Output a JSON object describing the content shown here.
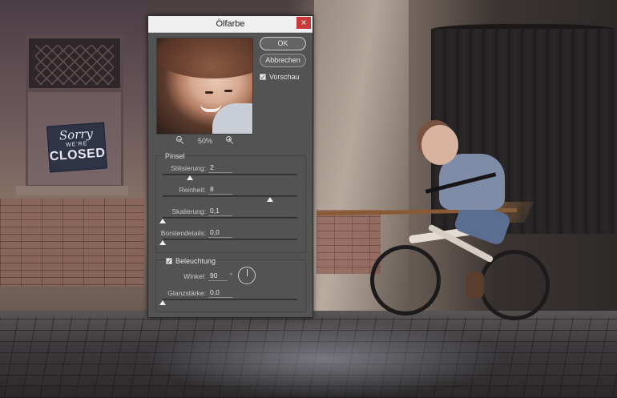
{
  "dialog": {
    "title": "Ölfarbe",
    "close_label": "×",
    "ok_label": "OK",
    "cancel_label": "Abbrechen",
    "preview_label": "Vorschau",
    "preview_checked": true,
    "zoom": "50%"
  },
  "pinsel": {
    "label": "Pinsel",
    "params": [
      {
        "label": "Stilisierung:",
        "value": "2",
        "fraction": 0.2
      },
      {
        "label": "Reinheit:",
        "value": "8",
        "fraction": 0.8
      },
      {
        "label": "Skalierung:",
        "value": "0,1",
        "fraction": 0.0
      },
      {
        "label": "Borstendetails:",
        "value": "0,0",
        "fraction": 0.0
      }
    ]
  },
  "lighting": {
    "label": "Beleuchtung",
    "checked": true,
    "angle_label": "Winkel:",
    "angle_value": "90",
    "degree_symbol": "°",
    "gloss_label": "Glanzstärke:",
    "gloss_value": "0,0",
    "gloss_fraction": 0.0
  },
  "scene": {
    "sign": {
      "line1": "Sorry",
      "line2": "WE'RE",
      "line3": "CLOSED"
    }
  },
  "colors": {
    "dialog_bg": "#535353",
    "titlebar_bg": "#f0f0f0",
    "close_button": "#c9383a"
  },
  "icons": {
    "zoom_out": "zoom-out-icon",
    "zoom_in": "zoom-in-icon",
    "close": "close-icon",
    "angle_dial": "angle-dial-icon"
  }
}
